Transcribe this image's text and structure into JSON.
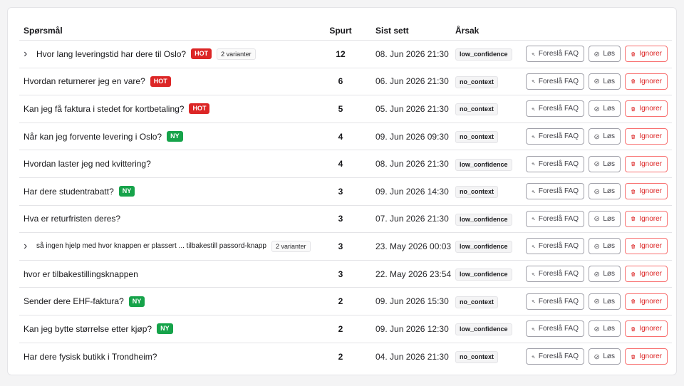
{
  "headers": {
    "question": "Spørsmål",
    "count": "Spurt",
    "last_seen": "Sist sett",
    "reason": "Årsak"
  },
  "actions": {
    "suggest_faq": "Foreslå FAQ",
    "solve": "Løs",
    "ignore": "Ignorer"
  },
  "rows": [
    {
      "question": "Hvor lang leveringstid har dere til Oslo?",
      "expandable": true,
      "badge": "HOT",
      "badge_type": "hot",
      "variants": "2 varianter",
      "count": "12",
      "last_seen": "08. Jun 2026 21:30",
      "reason": "low_confidence"
    },
    {
      "question": "Hvordan returnerer jeg en vare?",
      "expandable": false,
      "badge": "HOT",
      "badge_type": "hot",
      "variants": null,
      "count": "6",
      "last_seen": "06. Jun 2026 21:30",
      "reason": "no_context"
    },
    {
      "question": "Kan jeg få faktura i stedet for kortbetaling?",
      "expandable": false,
      "badge": "HOT",
      "badge_type": "hot",
      "variants": null,
      "count": "5",
      "last_seen": "05. Jun 2026 21:30",
      "reason": "no_context"
    },
    {
      "question": "Når kan jeg forvente levering i Oslo?",
      "expandable": false,
      "badge": "NY",
      "badge_type": "ny",
      "variants": null,
      "count": "4",
      "last_seen": "09. Jun 2026 09:30",
      "reason": "no_context"
    },
    {
      "question": "Hvordan laster jeg ned kvittering?",
      "expandable": false,
      "badge": null,
      "badge_type": null,
      "variants": null,
      "count": "4",
      "last_seen": "08. Jun 2026 21:30",
      "reason": "low_confidence"
    },
    {
      "question": "Har dere studentrabatt?",
      "expandable": false,
      "badge": "NY",
      "badge_type": "ny",
      "variants": null,
      "count": "3",
      "last_seen": "09. Jun 2026 14:30",
      "reason": "no_context"
    },
    {
      "question": "Hva er returfristen deres?",
      "expandable": false,
      "badge": null,
      "badge_type": null,
      "variants": null,
      "count": "3",
      "last_seen": "07. Jun 2026 21:30",
      "reason": "low_confidence"
    },
    {
      "question": "så ingen hjelp med hvor knappen er plassert ... tilbakestill passord-knapp",
      "expandable": true,
      "small": true,
      "badge": null,
      "badge_type": null,
      "variants": "2 varianter",
      "count": "3",
      "last_seen": "23. May 2026 00:03",
      "reason": "low_confidence"
    },
    {
      "question": "hvor er tilbakestillingsknappen",
      "expandable": false,
      "badge": null,
      "badge_type": null,
      "variants": null,
      "count": "3",
      "last_seen": "22. May 2026 23:54",
      "reason": "low_confidence"
    },
    {
      "question": "Sender dere EHF-faktura?",
      "expandable": false,
      "badge": "NY",
      "badge_type": "ny",
      "variants": null,
      "count": "2",
      "last_seen": "09. Jun 2026 15:30",
      "reason": "no_context"
    },
    {
      "question": "Kan jeg bytte størrelse etter kjøp?",
      "expandable": false,
      "badge": "NY",
      "badge_type": "ny",
      "variants": null,
      "count": "2",
      "last_seen": "09. Jun 2026 12:30",
      "reason": "low_confidence"
    },
    {
      "question": "Har dere fysisk butikk i Trondheim?",
      "expandable": false,
      "badge": null,
      "badge_type": null,
      "variants": null,
      "count": "2",
      "last_seen": "04. Jun 2026 21:30",
      "reason": "no_context"
    }
  ],
  "colors": {
    "hot": "#dc2626",
    "ny": "#16a34a",
    "ignore": "#dc2626"
  },
  "icons": {
    "expand": "chevron-right-icon",
    "faq": "sparkle-icon",
    "solve": "check-circle-icon",
    "ignore": "trash-icon"
  }
}
